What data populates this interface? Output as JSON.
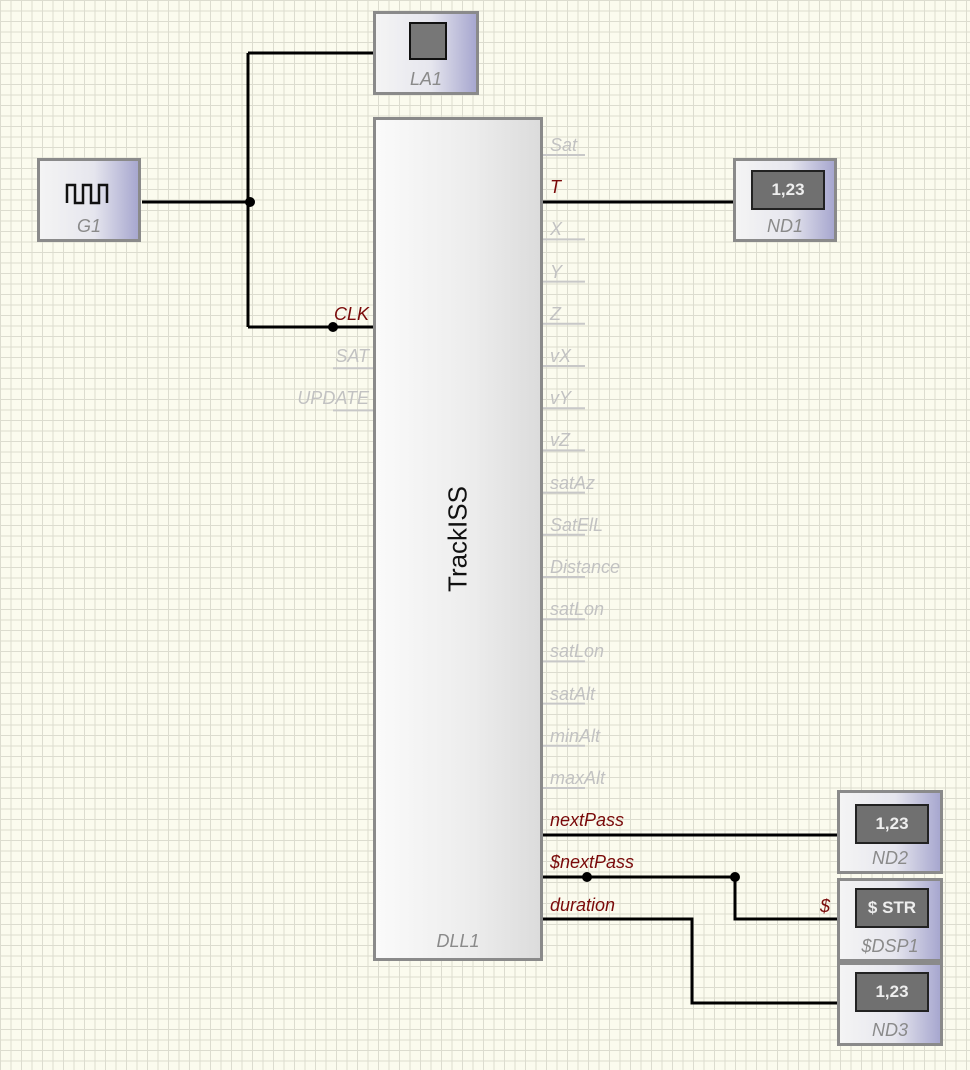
{
  "components": {
    "g1": {
      "name": "G1",
      "icon": "square-wave-icon"
    },
    "la1": {
      "name": "LA1"
    },
    "nd1": {
      "name": "ND1",
      "display": "1,23"
    },
    "nd2": {
      "name": "ND2",
      "display": "1,23"
    },
    "sdsp1": {
      "name": "$DSP1",
      "display": "$ STR",
      "pin": "$"
    },
    "nd3": {
      "name": "ND3",
      "display": "1,23"
    }
  },
  "dll": {
    "name": "DLL1",
    "title": "TrackISS",
    "inputs": [
      "CLK",
      "SAT",
      "UPDATE"
    ],
    "outputs": [
      "Sat",
      "T",
      "X",
      "Y",
      "Z",
      "vX",
      "vY",
      "vZ",
      "satAz",
      "SatElL",
      "Distance",
      "satLon",
      "satLon",
      "satAlt",
      "minAlt",
      "maxAlt",
      "nextPass",
      "$nextPass",
      "duration"
    ],
    "connected_inputs": [
      "CLK"
    ],
    "connected_outputs": [
      "T",
      "nextPass",
      "$nextPass",
      "duration"
    ]
  },
  "colors": {
    "wire": "#000000",
    "active_pin": "#7a0a0a",
    "inactive_pin": "#c2c2c2",
    "grid": "#dcdccf",
    "background": "#fbfbee"
  }
}
